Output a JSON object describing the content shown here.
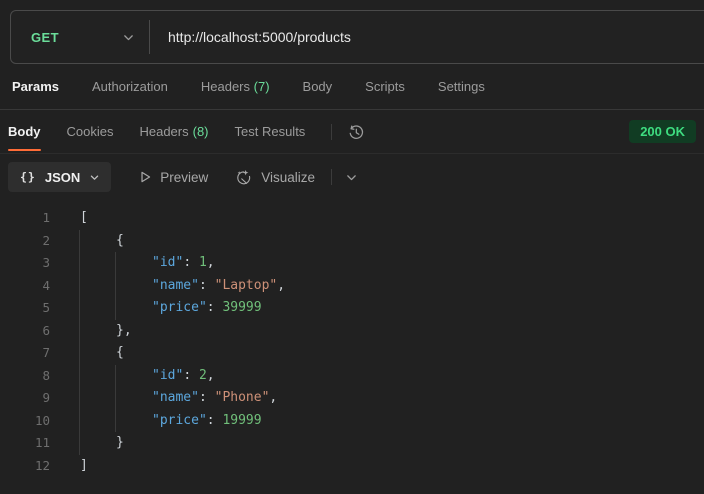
{
  "request": {
    "method": "GET",
    "url": "http://localhost:5000/products"
  },
  "request_tabs": {
    "items": [
      {
        "label": "Params",
        "active": true
      },
      {
        "label": "Authorization"
      },
      {
        "label": "Headers",
        "count": "(7)"
      },
      {
        "label": "Body"
      },
      {
        "label": "Scripts"
      },
      {
        "label": "Settings"
      }
    ]
  },
  "response": {
    "tabs": [
      {
        "label": "Body",
        "active": true
      },
      {
        "label": "Cookies"
      },
      {
        "label": "Headers",
        "count": "(8)"
      },
      {
        "label": "Test Results"
      }
    ],
    "status": "200 OK",
    "status_text_color": "#3edc80",
    "status_bg_color": "#113c23"
  },
  "viewer": {
    "braces_icon": "{}",
    "format": "JSON",
    "preview_label": "Preview",
    "visualize_label": "Visualize"
  },
  "colors": {
    "background": "#212121",
    "method_green": "#6bdd9a",
    "accent_orange": "#ff6c37",
    "code_key": "#5ca7dd",
    "code_string": "#ce9178",
    "code_number": "#70bf7a"
  },
  "code": {
    "lines": [
      {
        "n": 1,
        "guides": 0,
        "indent": 0,
        "tokens": [
          {
            "t": "p",
            "v": "["
          }
        ]
      },
      {
        "n": 2,
        "guides": 1,
        "indent": 1,
        "tokens": [
          {
            "t": "p",
            "v": "{"
          }
        ]
      },
      {
        "n": 3,
        "guides": 2,
        "indent": 2,
        "tokens": [
          {
            "t": "k",
            "v": "\"id\""
          },
          {
            "t": "p",
            "v": ": "
          },
          {
            "t": "n",
            "v": "1"
          },
          {
            "t": "p",
            "v": ","
          }
        ]
      },
      {
        "n": 4,
        "guides": 2,
        "indent": 2,
        "tokens": [
          {
            "t": "k",
            "v": "\"name\""
          },
          {
            "t": "p",
            "v": ": "
          },
          {
            "t": "s",
            "v": "\"Laptop\""
          },
          {
            "t": "p",
            "v": ","
          }
        ]
      },
      {
        "n": 5,
        "guides": 2,
        "indent": 2,
        "tokens": [
          {
            "t": "k",
            "v": "\"price\""
          },
          {
            "t": "p",
            "v": ": "
          },
          {
            "t": "n",
            "v": "39999"
          }
        ]
      },
      {
        "n": 6,
        "guides": 1,
        "indent": 1,
        "tokens": [
          {
            "t": "p",
            "v": "},"
          }
        ]
      },
      {
        "n": 7,
        "guides": 1,
        "indent": 1,
        "tokens": [
          {
            "t": "p",
            "v": "{"
          }
        ]
      },
      {
        "n": 8,
        "guides": 2,
        "indent": 2,
        "tokens": [
          {
            "t": "k",
            "v": "\"id\""
          },
          {
            "t": "p",
            "v": ": "
          },
          {
            "t": "n",
            "v": "2"
          },
          {
            "t": "p",
            "v": ","
          }
        ]
      },
      {
        "n": 9,
        "guides": 2,
        "indent": 2,
        "tokens": [
          {
            "t": "k",
            "v": "\"name\""
          },
          {
            "t": "p",
            "v": ": "
          },
          {
            "t": "s",
            "v": "\"Phone\""
          },
          {
            "t": "p",
            "v": ","
          }
        ]
      },
      {
        "n": 10,
        "guides": 2,
        "indent": 2,
        "tokens": [
          {
            "t": "k",
            "v": "\"price\""
          },
          {
            "t": "p",
            "v": ": "
          },
          {
            "t": "n",
            "v": "19999"
          }
        ]
      },
      {
        "n": 11,
        "guides": 1,
        "indent": 1,
        "tokens": [
          {
            "t": "p",
            "v": "}"
          }
        ]
      },
      {
        "n": 12,
        "guides": 0,
        "indent": 0,
        "tokens": [
          {
            "t": "p",
            "v": "]"
          }
        ]
      }
    ]
  }
}
